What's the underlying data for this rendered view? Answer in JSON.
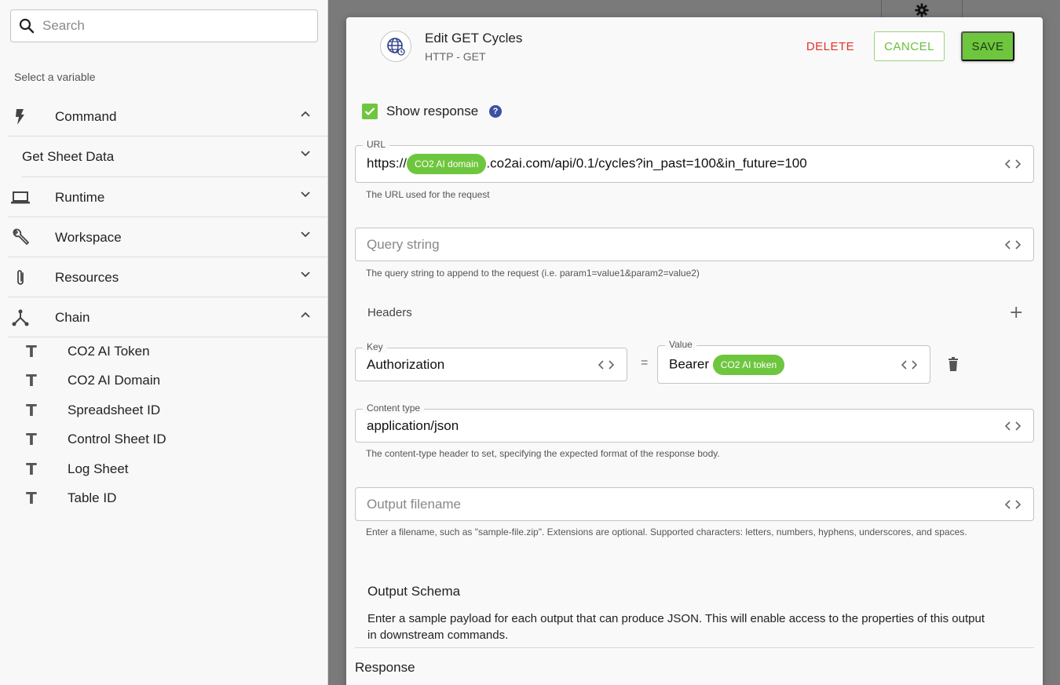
{
  "sidebar": {
    "search_placeholder": "Search",
    "select_label": "Select a variable",
    "groups": [
      {
        "label": "Command",
        "icon": "lightning-icon",
        "expanded": true
      },
      {
        "label": "Get Sheet Data",
        "expanded": false
      },
      {
        "label": "Runtime",
        "icon": "laptop-icon",
        "expanded": false
      },
      {
        "label": "Workspace",
        "icon": "wrench-icon",
        "expanded": false
      },
      {
        "label": "Resources",
        "icon": "paperclip-icon",
        "expanded": false
      },
      {
        "label": "Chain",
        "icon": "chain-icon",
        "expanded": true
      }
    ],
    "chain_items": [
      {
        "label": "CO2 AI Token",
        "icon": "text-type-icon"
      },
      {
        "label": "CO2 AI Domain",
        "icon": "text-type-icon"
      },
      {
        "label": "Spreadsheet ID",
        "icon": "text-type-icon"
      },
      {
        "label": "Control Sheet ID",
        "icon": "text-type-icon"
      },
      {
        "label": "Log Sheet",
        "icon": "text-type-icon"
      },
      {
        "label": "Table ID",
        "icon": "text-type-icon"
      }
    ],
    "type_glyph": "T"
  },
  "modal": {
    "title": "Edit GET Cycles",
    "subtitle": "HTTP - GET",
    "icon": "globe-icon",
    "delete_label": "DELETE",
    "cancel_label": "CANCEL",
    "save_label": "SAVE",
    "show_response": {
      "label": "Show response",
      "checked": true,
      "help": "?"
    },
    "url": {
      "label": "URL",
      "prefix": "https://",
      "chip": "CO2 AI domain",
      "suffix": ".co2ai.com/api/0.1/cycles?in_past=100&in_future=100",
      "helper": "The URL used for the request"
    },
    "query_string": {
      "placeholder": "Query string",
      "helper": "The query string to append to the request (i.e. param1=value1&param2=value2)"
    },
    "headers": {
      "label": "Headers",
      "key_label": "Key",
      "key_value": "Authorization",
      "equals": "=",
      "value_label": "Value",
      "value_prefix": "Bearer",
      "value_chip": "CO2 AI token"
    },
    "content_type": {
      "label": "Content type",
      "value": "application/json",
      "helper": "The content-type header to set, specifying the expected format of the response body."
    },
    "output_filename": {
      "placeholder": "Output filename",
      "helper": "Enter a filename, such as \"sample-file.zip\". Extensions are optional. Supported characters: letters, numbers, hyphens, underscores, and spaces."
    },
    "output_schema": {
      "title": "Output Schema",
      "description": "Enter a sample payload for each output that can produce JSON. This will enable access to the properties of this output in downstream commands."
    },
    "response_label": "Response"
  },
  "colors": {
    "accent_green": "#6ec63e",
    "delete_red": "#e0322a",
    "help_blue": "#3f4ea5",
    "overlay": "#7a7a7a"
  }
}
